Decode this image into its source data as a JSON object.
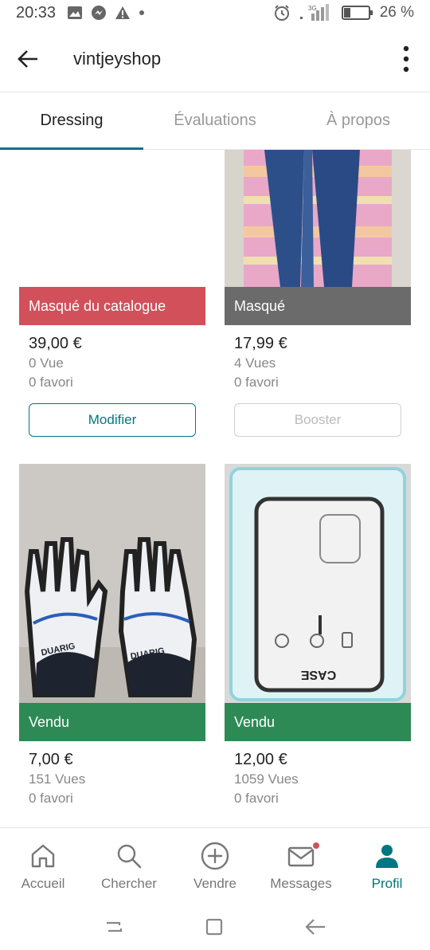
{
  "status_bar": {
    "time": "20:33",
    "network": "3G",
    "battery_percent_label": "26 %",
    "battery_level": 0.26
  },
  "app_bar": {
    "title": "vintjeyshop",
    "back_icon": "arrow-left-icon",
    "menu_icon": "more-vertical-icon"
  },
  "tabs": [
    {
      "label": "Dressing",
      "active": true
    },
    {
      "label": "Évaluations",
      "active": false
    },
    {
      "label": "À propos",
      "active": false
    }
  ],
  "items": [
    {
      "status": "Masqué du catalogue",
      "price": "39,00 €",
      "views": "0 Vue",
      "favorites": "0 favori",
      "button": "Modifier"
    },
    {
      "status": "Masqué",
      "price": "17,99 €",
      "views": "4 Vues",
      "favorites": "0 favori",
      "button": "Booster"
    },
    {
      "status": "Vendu",
      "price": "7,00 €",
      "views": "151 Vues",
      "favorites": "0 favori"
    },
    {
      "status": "Vendu",
      "price": "12,00 €",
      "views": "1059 Vues",
      "favorites": "0 favori"
    }
  ],
  "photo_text": {
    "gloves_brand": "DUARIG",
    "case_brand": "CASE"
  },
  "bottom_nav": [
    {
      "label": "Accueil",
      "icon": "home-icon"
    },
    {
      "label": "Chercher",
      "icon": "search-icon"
    },
    {
      "label": "Vendre",
      "icon": "plus-circle-icon"
    },
    {
      "label": "Messages",
      "icon": "mail-icon",
      "notification": true
    },
    {
      "label": "Profil",
      "icon": "person-icon",
      "active": true
    }
  ],
  "colors": {
    "accent": "#007782",
    "hidden_badge": "#d2505a",
    "masked_badge": "#6b6b6b",
    "sold_badge": "#2e8a55"
  }
}
